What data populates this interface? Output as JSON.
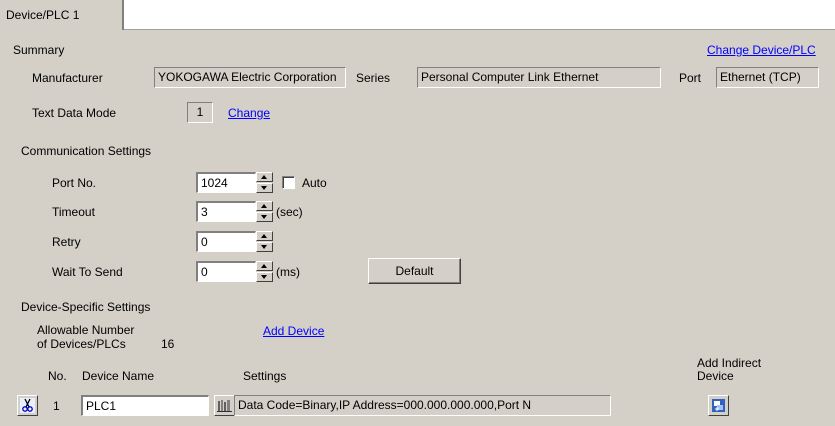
{
  "tab": {
    "label": "Device/PLC 1"
  },
  "summary": {
    "heading": "Summary",
    "change_device_link": "Change Device/PLC",
    "manufacturer_label": "Manufacturer",
    "manufacturer_value": "YOKOGAWA Electric Corporation",
    "series_label": "Series",
    "series_value": "Personal Computer Link Ethernet",
    "port_label": "Port",
    "port_value": "Ethernet (TCP)",
    "text_data_mode_label": "Text Data Mode",
    "text_data_mode_value": "1",
    "change_link": "Change"
  },
  "communication": {
    "heading": "Communication Settings",
    "port_no_label": "Port No.",
    "port_no_value": "1024",
    "auto_label": "Auto",
    "timeout_label": "Timeout",
    "timeout_value": "3",
    "timeout_unit": "(sec)",
    "retry_label": "Retry",
    "retry_value": "0",
    "wait_label": "Wait To Send",
    "wait_value": "0",
    "wait_unit": "(ms)",
    "default_button": "Default"
  },
  "device_specific": {
    "heading": "Device-Specific Settings",
    "allowable_line1": "Allowable Number",
    "allowable_line2": "of Devices/PLCs",
    "allowable_value": "16",
    "add_device_link": "Add Device",
    "add_indirect_line1": "Add Indirect",
    "add_indirect_line2": "Device",
    "columns": {
      "no": "No.",
      "device_name": "Device Name",
      "settings": "Settings"
    },
    "rows": [
      {
        "no": "1",
        "device_name": "PLC1",
        "settings": "Data Code=Binary,IP Address=000.000.000.000,Port N"
      }
    ]
  }
}
